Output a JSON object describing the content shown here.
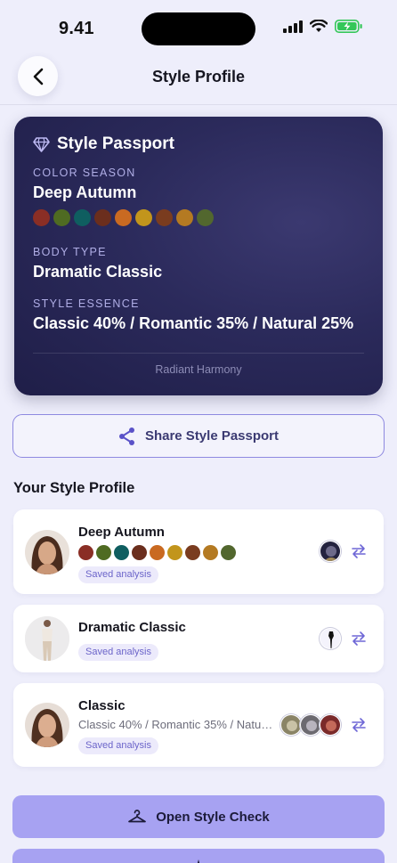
{
  "status": {
    "time": "9.41"
  },
  "header": {
    "title": "Style Profile",
    "back_icon": "chevron-left-icon"
  },
  "passport": {
    "title": "Style Passport",
    "icon": "diamond-icon",
    "color_season_label": "COLOR SEASON",
    "color_season_value": "Deep Autumn",
    "palette": [
      "#8a2e25",
      "#4f6b22",
      "#0f5e60",
      "#6b2e1d",
      "#c96a21",
      "#c2951c",
      "#7a3c1f",
      "#b47a22",
      "#52672e"
    ],
    "body_type_label": "BODY TYPE",
    "body_type_value": "Dramatic Classic",
    "style_essence_label": "STYLE ESSENCE",
    "style_essence_value": "Classic 40% / Romantic 35% / Natural 25%",
    "footer": "Radiant Harmony"
  },
  "share_button": {
    "label": "Share Style Passport",
    "icon": "share-icon"
  },
  "section_title": "Your Style Profile",
  "profiles": [
    {
      "title": "Deep Autumn",
      "badge": "Saved analysis",
      "palette": [
        "#8a2e25",
        "#4f6b22",
        "#0f5e60",
        "#6b2e1d",
        "#c96a21",
        "#c2951c",
        "#7a3c1f",
        "#b47a22",
        "#52672e"
      ]
    },
    {
      "title": "Dramatic Classic",
      "badge": "Saved analysis"
    },
    {
      "title": "Classic",
      "subtitle": "Classic 40% / Romantic 35% / Natu…",
      "badge": "Saved analysis"
    }
  ],
  "style_check_button": {
    "label": "Open Style Check",
    "icon": "hanger-icon"
  }
}
